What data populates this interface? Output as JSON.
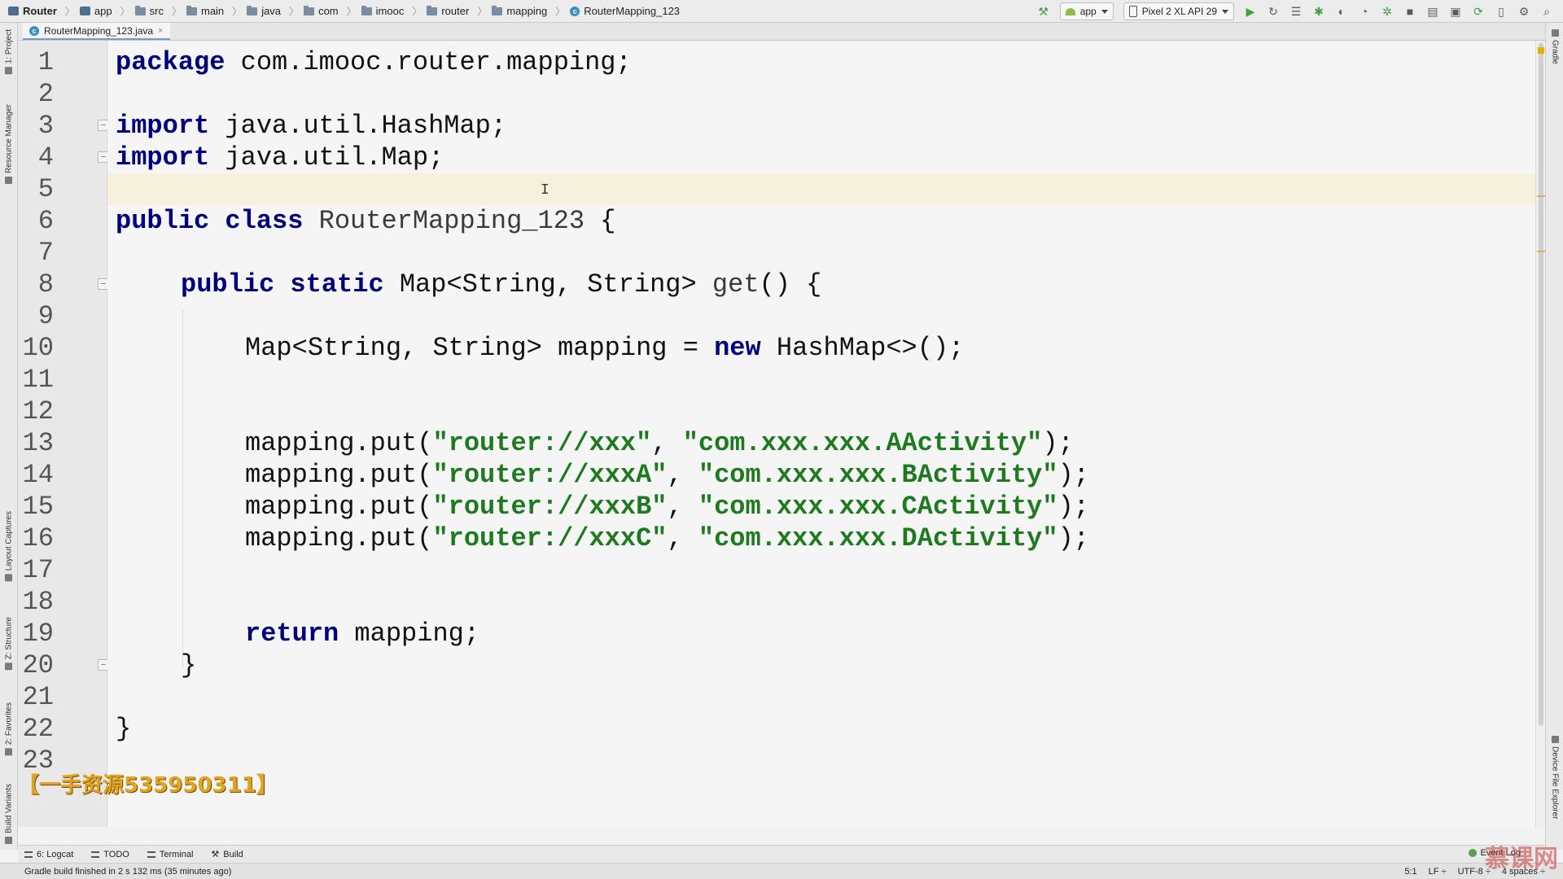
{
  "breadcrumb": [
    "Router",
    "app",
    "src",
    "main",
    "java",
    "com",
    "imooc",
    "router",
    "mapping",
    "RouterMapping_123"
  ],
  "toolbar": {
    "run_config": "app",
    "device": "Pixel 2 XL API 29"
  },
  "editor_tab": {
    "label": "RouterMapping_123.java",
    "close": "×"
  },
  "left_tool_windows": [
    "1: Project",
    "Resource Manager",
    "Layout Captures",
    "Z: Structure",
    "2: Favorites",
    "Build Variants"
  ],
  "right_tool_windows": [
    "Gradle",
    "Device File Explorer"
  ],
  "line_numbers": [
    "1",
    "2",
    "3",
    "4",
    "5",
    "6",
    "7",
    "8",
    "9",
    "10",
    "11",
    "12",
    "13",
    "14",
    "15",
    "16",
    "17",
    "18",
    "19",
    "20",
    "21",
    "22",
    "23"
  ],
  "code": {
    "kw_package": "package",
    "package_name": " com.imooc.router.mapping;",
    "kw_import": "import",
    "import_hashmap": " java.util.HashMap;",
    "import_map": " java.util.Map;",
    "kw_public": "public",
    "kw_class": "class",
    "class_name": "RouterMapping_123",
    "open_brace": " {",
    "kw_static": "static",
    "return_type": " Map<String, String> ",
    "method_name": "get",
    "method_tail": "() {",
    "mapping_decl": "Map<String, String> mapping = ",
    "kw_new": "new",
    "new_tail": " HashMap<>();",
    "put_prefix": "mapping.put(",
    "puts": [
      {
        "key": "\"router://xxx\"",
        "value": "\"com.xxx.xxx.AActivity\""
      },
      {
        "key": "\"router://xxxA\"",
        "value": "\"com.xxx.xxx.BActivity\""
      },
      {
        "key": "\"router://xxxB\"",
        "value": "\"com.xxx.xxx.CActivity\""
      },
      {
        "key": "\"router://xxxC\"",
        "value": "\"com.xxx.xxx.DActivity\""
      }
    ],
    "put_sep": ", ",
    "put_suffix": ");",
    "kw_return": "return",
    "return_tail": " mapping;",
    "close_brace": "}"
  },
  "watermark": "【一手资源535950311】",
  "bottom_tabs": [
    "6: Logcat",
    "TODO",
    "Terminal",
    "Build"
  ],
  "event_log": "Event Log",
  "status": {
    "message": "Gradle build finished in 2 s 132 ms (35 minutes ago)",
    "position": "5:1",
    "line_sep": "LF ÷",
    "encoding": "UTF-8 ÷",
    "indent": "4 spaces ÷"
  },
  "brand": "慕课网"
}
